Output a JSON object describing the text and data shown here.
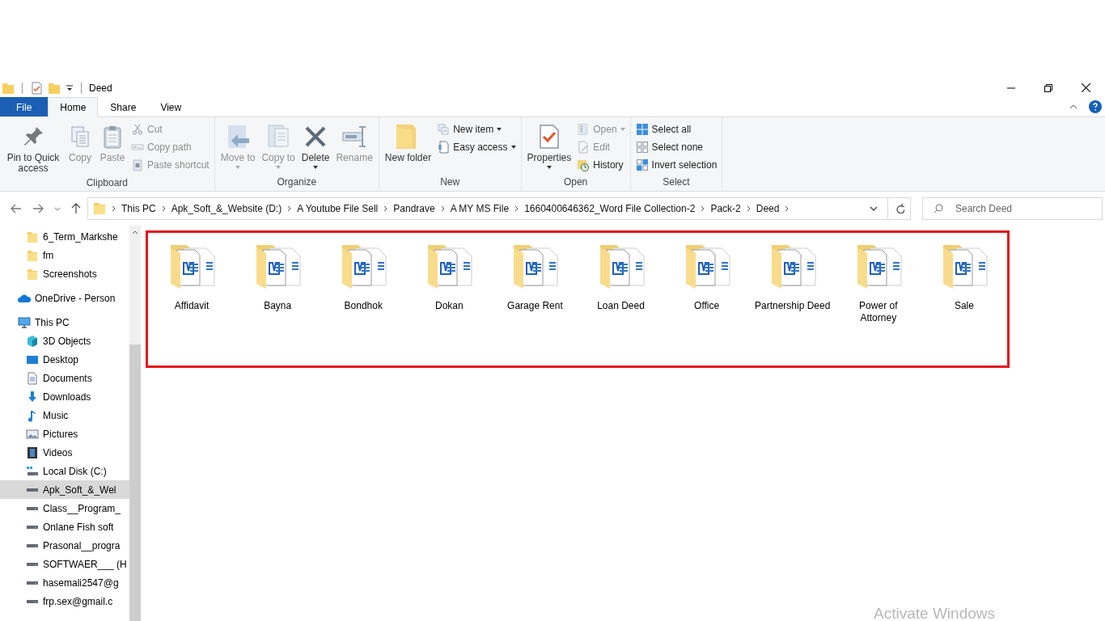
{
  "window": {
    "title": "Deed"
  },
  "tabs": [
    {
      "label": "File",
      "kind": "file",
      "selected": false
    },
    {
      "label": "Home",
      "kind": "tab",
      "selected": true
    },
    {
      "label": "Share",
      "kind": "tab",
      "selected": false
    },
    {
      "label": "View",
      "kind": "tab",
      "selected": false
    }
  ],
  "ribbon": {
    "groups": [
      {
        "label": "Clipboard",
        "items": [
          {
            "label": "Pin to Quick access",
            "kind": "large",
            "disabled": false,
            "dropdown": false
          },
          {
            "label": "Copy",
            "kind": "large",
            "disabled": true,
            "dropdown": false
          },
          {
            "label": "Paste",
            "kind": "large",
            "disabled": true,
            "dropdown": false
          },
          {
            "label": "Cut",
            "kind": "small",
            "disabled": true,
            "dropdown": false
          },
          {
            "label": "Copy path",
            "kind": "small",
            "disabled": true,
            "dropdown": false
          },
          {
            "label": "Paste shortcut",
            "kind": "small",
            "disabled": true,
            "dropdown": false
          }
        ]
      },
      {
        "label": "Organize",
        "items": [
          {
            "label": "Move to",
            "kind": "large",
            "disabled": true,
            "dropdown": true
          },
          {
            "label": "Copy to",
            "kind": "large",
            "disabled": true,
            "dropdown": true
          },
          {
            "label": "Delete",
            "kind": "large",
            "disabled": false,
            "dropdown": true
          },
          {
            "label": "Rename",
            "kind": "large",
            "disabled": true,
            "dropdown": false
          }
        ]
      },
      {
        "label": "New",
        "items": [
          {
            "label": "New folder",
            "kind": "large",
            "disabled": false,
            "dropdown": false
          },
          {
            "label": "New item",
            "kind": "small",
            "disabled": false,
            "dropdown": true
          },
          {
            "label": "Easy access",
            "kind": "small",
            "disabled": false,
            "dropdown": true
          }
        ]
      },
      {
        "label": "Open",
        "items": [
          {
            "label": "Properties",
            "kind": "large",
            "disabled": false,
            "dropdown": true
          },
          {
            "label": "Open",
            "kind": "small",
            "disabled": true,
            "dropdown": true
          },
          {
            "label": "Edit",
            "kind": "small",
            "disabled": true,
            "dropdown": false
          },
          {
            "label": "History",
            "kind": "small",
            "disabled": false,
            "dropdown": false
          }
        ]
      },
      {
        "label": "Select",
        "items": [
          {
            "label": "Select all",
            "kind": "small",
            "disabled": false,
            "dropdown": false
          },
          {
            "label": "Select none",
            "kind": "small",
            "disabled": false,
            "dropdown": false
          },
          {
            "label": "Invert selection",
            "kind": "small",
            "disabled": false,
            "dropdown": false
          }
        ]
      }
    ]
  },
  "address_bar": {
    "segments": [
      "This PC",
      "Apk_Soft_&_Website (D:)",
      "A Youtube File Sell",
      "Pandrave",
      "A MY MS File",
      "1660400646362_Word File Collection-2",
      "Pack-2",
      "Deed"
    ]
  },
  "search": {
    "placeholder": "Search Deed"
  },
  "sidebar": {
    "items": [
      {
        "label": "6_Term_Markshe",
        "kind": "folder",
        "selected": false
      },
      {
        "label": "fm",
        "kind": "folder",
        "selected": false
      },
      {
        "label": "Screenshots",
        "kind": "folder",
        "selected": false
      },
      {
        "label": "OneDrive - Person",
        "kind": "cloud",
        "selected": false
      },
      {
        "label": "This PC",
        "kind": "pc",
        "selected": false,
        "children": [
          {
            "label": "3D Objects",
            "kind": "cube",
            "selected": false
          },
          {
            "label": "Desktop",
            "kind": "desktop",
            "selected": false
          },
          {
            "label": "Documents",
            "kind": "documents",
            "selected": false
          },
          {
            "label": "Downloads",
            "kind": "downloads",
            "selected": false
          },
          {
            "label": "Music",
            "kind": "music",
            "selected": false
          },
          {
            "label": "Pictures",
            "kind": "pictures",
            "selected": false
          },
          {
            "label": "Videos",
            "kind": "videos",
            "selected": false
          },
          {
            "label": "Local Disk (C:)",
            "kind": "sysdisk",
            "selected": false
          },
          {
            "label": "Apk_Soft_&_Wel",
            "kind": "drive",
            "selected": true
          },
          {
            "label": "Class__Program_",
            "kind": "drive",
            "selected": false
          },
          {
            "label": "Onlane Fish soft",
            "kind": "drive",
            "selected": false
          },
          {
            "label": "Prasonal__progra",
            "kind": "drive",
            "selected": false
          },
          {
            "label": "SOFTWAER___ (H",
            "kind": "drive",
            "selected": false
          },
          {
            "label": "hasemali2547@g",
            "kind": "drive",
            "selected": false
          },
          {
            "label": "frp.sex@gmail.c",
            "kind": "drive",
            "selected": false
          }
        ]
      }
    ]
  },
  "folders": [
    {
      "name": "Affidavit"
    },
    {
      "name": "Bayna"
    },
    {
      "name": "Bondhok"
    },
    {
      "name": "Dokan"
    },
    {
      "name": "Garage Rent"
    },
    {
      "name": "Loan Deed"
    },
    {
      "name": "Office"
    },
    {
      "name": "Partnership Deed"
    },
    {
      "name": "Power of Attorney"
    },
    {
      "name": "Sale"
    }
  ],
  "activation_notice": "Activate Windows"
}
